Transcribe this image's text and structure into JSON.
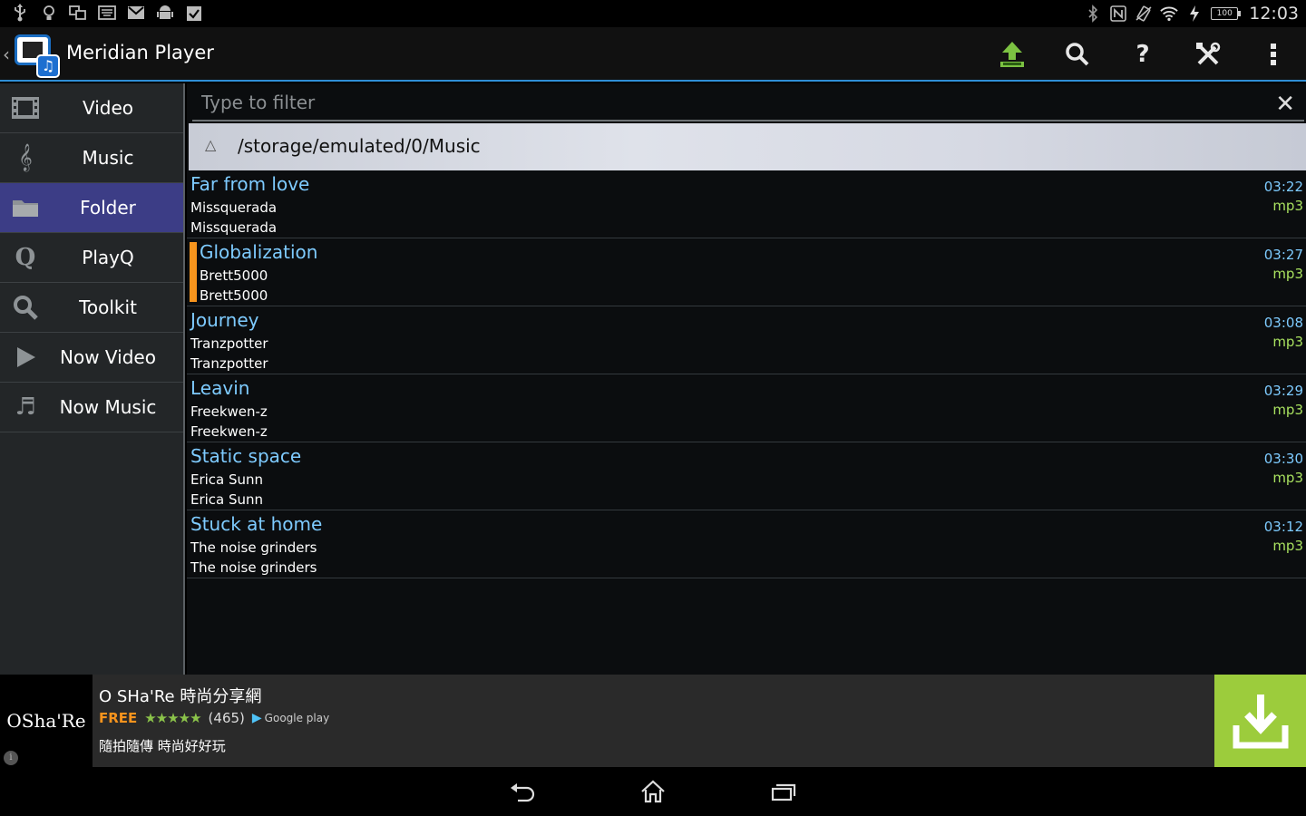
{
  "status_bar": {
    "time": "12:03",
    "battery": "100",
    "left_icons": [
      "usb-icon",
      "lightbulb-icon",
      "devices-icon",
      "keyboard-icon",
      "gmail-icon",
      "android-icon",
      "clipboard-check-icon"
    ],
    "right_icons": [
      "bluetooth-icon",
      "nfc-icon",
      "vibrate-off-icon",
      "wifi-icon",
      "charging-icon"
    ]
  },
  "action_bar": {
    "title": "Meridian Player",
    "actions": [
      {
        "name": "upload-icon",
        "label": "Upload"
      },
      {
        "name": "search-icon",
        "label": "Search"
      },
      {
        "name": "help-icon",
        "label": "Help"
      },
      {
        "name": "tools-icon",
        "label": "Tools"
      },
      {
        "name": "overflow-menu-icon",
        "label": "More"
      }
    ]
  },
  "sidebar": {
    "items": [
      {
        "label": "Video",
        "icon": "film-icon"
      },
      {
        "label": "Music",
        "icon": "treble-clef-icon"
      },
      {
        "label": "Folder",
        "icon": "folder-icon",
        "active": true
      },
      {
        "label": "PlayQ",
        "icon": "playq-icon"
      },
      {
        "label": "Toolkit",
        "icon": "toolkit-icon"
      },
      {
        "label": "Now Video",
        "icon": "play-icon"
      },
      {
        "label": "Now Music",
        "icon": "music-note-icon"
      }
    ]
  },
  "filter": {
    "placeholder": "Type to filter",
    "value": ""
  },
  "path": "/storage/emulated/0/Music",
  "tracks": [
    {
      "title": "Far from love",
      "artist": "Missquerada",
      "album": "Missquerada",
      "duration": "03:22",
      "format": "mp3",
      "playing": false
    },
    {
      "title": "Globalization",
      "artist": "Brett5000",
      "album": "Brett5000",
      "duration": "03:27",
      "format": "mp3",
      "playing": true
    },
    {
      "title": "Journey",
      "artist": "Tranzpotter",
      "album": "Tranzpotter",
      "duration": "03:08",
      "format": "mp3",
      "playing": false
    },
    {
      "title": "Leavin",
      "artist": "Freekwen-z",
      "album": "Freekwen-z",
      "duration": "03:29",
      "format": "mp3",
      "playing": false
    },
    {
      "title": "Static space",
      "artist": "Erica Sunn",
      "album": "Erica Sunn",
      "duration": "03:30",
      "format": "mp3",
      "playing": false
    },
    {
      "title": "Stuck at home",
      "artist": "The noise grinders",
      "album": "The noise grinders",
      "duration": "03:12",
      "format": "mp3",
      "playing": false
    }
  ],
  "ad": {
    "logo_text": "OSha'Re",
    "title": "O SHa'Re 時尚分享網",
    "free": "FREE",
    "stars": "★★★★★",
    "rating_count": "(465)",
    "store": "Google play",
    "description": "隨拍隨傳 時尚好好玩",
    "info": "i"
  },
  "colors": {
    "accent": "#2f8fd6",
    "active_nav": "#3c3d86",
    "track_title": "#7ecbff",
    "format": "#a8e05f",
    "playing_marker": "#f7941d",
    "ad_download": "#9ccc3c"
  }
}
